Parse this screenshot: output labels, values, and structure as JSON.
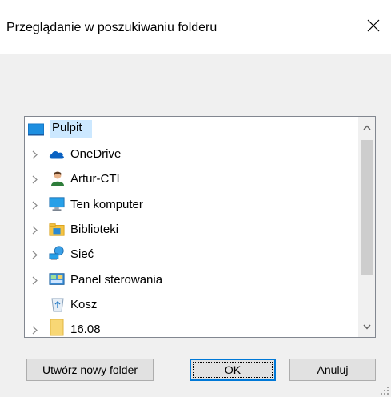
{
  "dialog": {
    "title": "Przeglądanie w poszukiwaniu folderu",
    "close_label": "close"
  },
  "tree": {
    "items": [
      {
        "label": "Pulpit",
        "icon": "desktop-icon",
        "expandable": false,
        "selected": true,
        "level": 0
      },
      {
        "label": "OneDrive",
        "icon": "onedrive-cloud-icon",
        "expandable": true,
        "selected": false,
        "level": 1
      },
      {
        "label": "Artur-CTI",
        "icon": "user-icon",
        "expandable": true,
        "selected": false,
        "level": 1
      },
      {
        "label": "Ten komputer",
        "icon": "computer-icon",
        "expandable": true,
        "selected": false,
        "level": 1
      },
      {
        "label": "Biblioteki",
        "icon": "libraries-icon",
        "expandable": true,
        "selected": false,
        "level": 1
      },
      {
        "label": "Sieć",
        "icon": "network-icon",
        "expandable": true,
        "selected": false,
        "level": 1
      },
      {
        "label": "Panel sterowania",
        "icon": "control-panel-icon",
        "expandable": true,
        "selected": false,
        "level": 1
      },
      {
        "label": "Kosz",
        "icon": "recycle-bin-icon",
        "expandable": false,
        "selected": false,
        "level": 1
      },
      {
        "label": "16.08",
        "icon": "folder-icon",
        "expandable": true,
        "selected": false,
        "level": 1
      }
    ]
  },
  "buttons": {
    "new_folder_first": "U",
    "new_folder_rest": "twórz nowy folder",
    "ok": "OK",
    "cancel": "Anuluj"
  },
  "colors": {
    "selection": "#cce8ff",
    "accent": "#0078d7",
    "window_bg": "#f0f0f0"
  }
}
